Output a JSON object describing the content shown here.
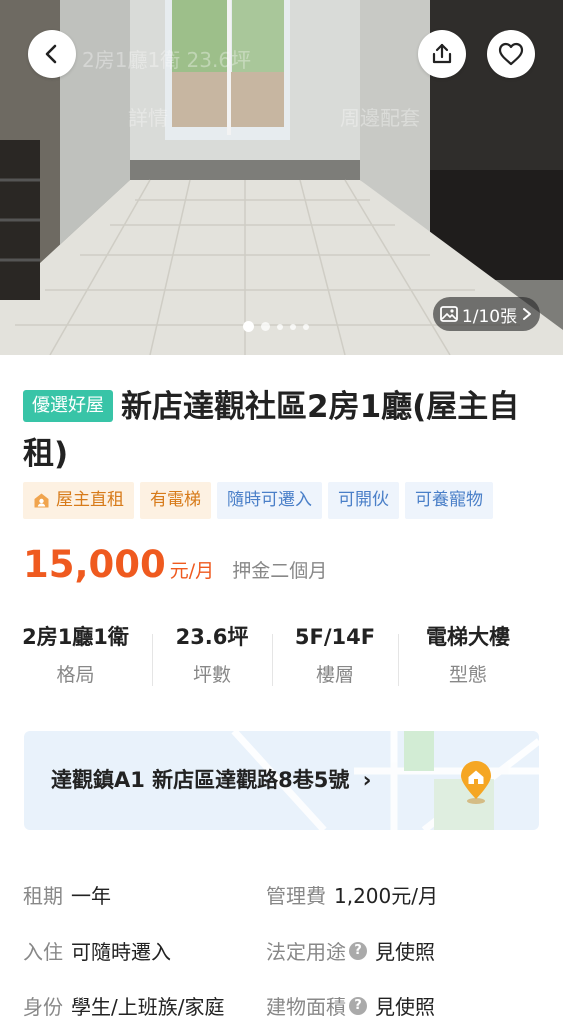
{
  "gallery": {
    "counter": "1/10張",
    "watermark_title": "2房1廳1衛 23.6坪",
    "watermark_tab_detail": "詳情",
    "watermark_tab_nearby": "周邊配套",
    "current_slide": 1,
    "total_slides": 10
  },
  "listing": {
    "badge": "優選好屋",
    "title": "新店達觀社區2房1廳(屋主自租)"
  },
  "tags": [
    {
      "label": "屋主直租",
      "style": "orange",
      "icon": "owner-icon"
    },
    {
      "label": "有電梯",
      "style": "orange"
    },
    {
      "label": "隨時可遷入",
      "style": "blue"
    },
    {
      "label": "可開伙",
      "style": "blue"
    },
    {
      "label": "可養寵物",
      "style": "blue"
    }
  ],
  "price": {
    "amount": "15,000",
    "unit": "元/月",
    "deposit": "押金二個月"
  },
  "specs": [
    {
      "value": "2房1廳1衛",
      "label": "格局"
    },
    {
      "value": "23.6坪",
      "label": "坪數"
    },
    {
      "value": "5F/14F",
      "label": "樓層"
    },
    {
      "value": "電梯大樓",
      "label": "型態"
    }
  ],
  "location": {
    "address": "達觀鎮A1 新店區達觀路8巷5號"
  },
  "details": {
    "lease_term": {
      "key": "租期",
      "value": "一年"
    },
    "management_fee": {
      "key": "管理費",
      "value": "1,200元/月"
    },
    "move_in": {
      "key": "入住",
      "value": "可隨時遷入"
    },
    "legal_use": {
      "key": "法定用途",
      "value": "見使照"
    },
    "identity": {
      "key": "身份",
      "value": "學生/上班族/家庭"
    },
    "building_area": {
      "key": "建物面積",
      "value": "見使照"
    }
  },
  "colors": {
    "price": "#ef5a1f",
    "badge": "#38c4a7",
    "tag_orange_bg": "#fdf1e2",
    "tag_blue_bg": "#eef4fc",
    "map_bg": "#e9f2fb",
    "pin": "#f5a623"
  }
}
